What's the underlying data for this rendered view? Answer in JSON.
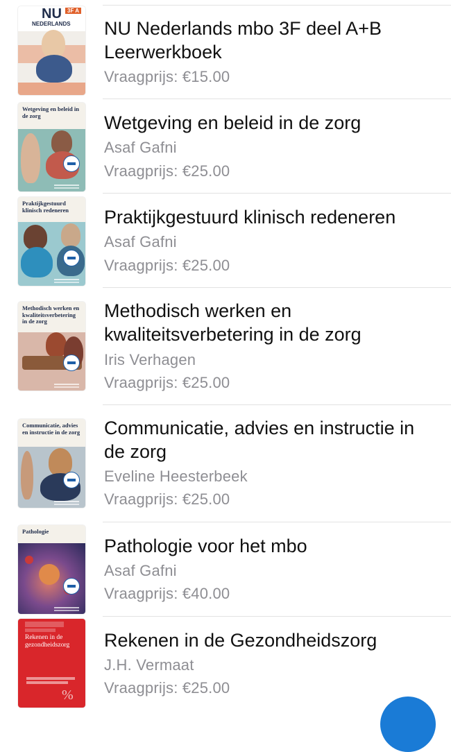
{
  "listings": [
    {
      "title": "NU Nederlands mbo 3F deel A+B Leerwerkboek",
      "author": "",
      "price": "Vraagprijs: €15.00",
      "cover": {
        "text_top": "NU",
        "text_sub": "NEDERLANDS",
        "text_tag": "3F A",
        "bg": "#f1eee9",
        "accent": "#e0602a"
      }
    },
    {
      "title": "Wetgeving en beleid in de zorg",
      "author": "Asaf Gafni",
      "price": "Vraagprijs: €25.00",
      "cover": {
        "text": "Wetgeving en beleid in de zorg",
        "bg": "#f4f1ea",
        "accent": "#3a8f8a"
      }
    },
    {
      "title": "Praktijkgestuurd klinisch redeneren",
      "author": "Asaf Gafni",
      "price": "Vraagprijs: €25.00",
      "cover": {
        "text": "Praktijkgestuurd klinisch redeneren",
        "bg": "#f4f1ea",
        "accent": "#2f9ab0"
      }
    },
    {
      "title": "Methodisch werken en kwaliteitsverbetering in de zorg",
      "author": "Iris Verhagen",
      "price": "Vraagprijs: €25.00",
      "cover": {
        "text": "Methodisch werken en kwaliteitsverbetering in de zorg",
        "bg": "#f4f1ea",
        "accent": "#b9705a"
      }
    },
    {
      "title": "Communicatie, advies en instructie in de zorg",
      "author": "Eveline Heesterbeek",
      "price": "Vraagprijs: €25.00",
      "cover": {
        "text": "Communicatie, advies en instructie in de zorg",
        "bg": "#f4f1ea",
        "accent": "#6e8fa8"
      }
    },
    {
      "title": "Pathologie voor het mbo",
      "author": "Asaf Gafni",
      "price": "Vraagprijs: €40.00",
      "cover": {
        "text": "Pathologie",
        "bg": "#f4f1ea",
        "accent": "#7a4a8c"
      }
    },
    {
      "title": "Rekenen in de Gezondheidszorg",
      "author": "J.H. Vermaat",
      "price": "Vraagprijs: €25.00",
      "cover": {
        "text": "Rekenen in de gezondheidszorg",
        "bg": "#d9262b",
        "accent": "#ffffff"
      }
    }
  ],
  "colors": {
    "title": "#111111",
    "secondary": "#8e8e93",
    "separator": "#e2e2e2",
    "fab": "#1a7bd6"
  }
}
